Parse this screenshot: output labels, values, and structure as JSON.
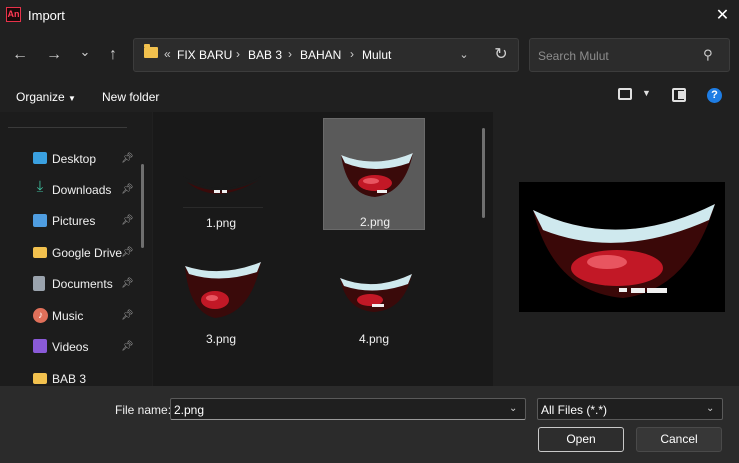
{
  "window": {
    "title": "Import",
    "app_badge": "An",
    "close_glyph": "✕"
  },
  "nav": {
    "back_glyph": "←",
    "forward_glyph": "→",
    "recent_glyph": "⌄",
    "up_glyph": "↑",
    "breadcrumb_prefix": "«",
    "breadcrumbs": [
      "FIX BARU",
      "BAB 3",
      "BAHAN",
      "Mulut"
    ],
    "refresh_glyph": "↻",
    "search_placeholder": "Search Mulut"
  },
  "toolbar": {
    "organize_label": "Organize",
    "new_folder_label": "New folder",
    "help_glyph": "?"
  },
  "sidebar": {
    "items": [
      {
        "label": "Desktop",
        "icon": "desktop-icon",
        "color": "#3aa0e0",
        "pinned": true
      },
      {
        "label": "Downloads",
        "icon": "download-icon",
        "color": "#3fbf9f",
        "pinned": true
      },
      {
        "label": "Pictures",
        "icon": "pictures-icon",
        "color": "#4f9de0",
        "pinned": true
      },
      {
        "label": "Google Drive",
        "icon": "folder-icon",
        "color": "#f2c14e",
        "pinned": true
      },
      {
        "label": "Documents",
        "icon": "documents-icon",
        "color": "#9aa3ad",
        "pinned": true
      },
      {
        "label": "Music",
        "icon": "music-icon",
        "color": "#e0705a",
        "pinned": true
      },
      {
        "label": "Videos",
        "icon": "videos-icon",
        "color": "#8a5ad8",
        "pinned": true
      },
      {
        "label": "BAB 3",
        "icon": "folder-icon",
        "color": "#f2c14e",
        "pinned": false
      }
    ]
  },
  "files": [
    {
      "name": "1.png",
      "selected": false
    },
    {
      "name": "2.png",
      "selected": true
    },
    {
      "name": "3.png",
      "selected": false
    },
    {
      "name": "4.png",
      "selected": false
    }
  ],
  "footer": {
    "file_name_label": "File name:",
    "file_name_value": "2.png",
    "file_type_value": "All Files (*.*)",
    "open_label": "Open",
    "cancel_label": "Cancel"
  },
  "colors": {
    "accent": "#1e7de4",
    "selection": "#5a5a5a",
    "folder": "#f2c14e",
    "app_brand": "#ff3b55"
  }
}
